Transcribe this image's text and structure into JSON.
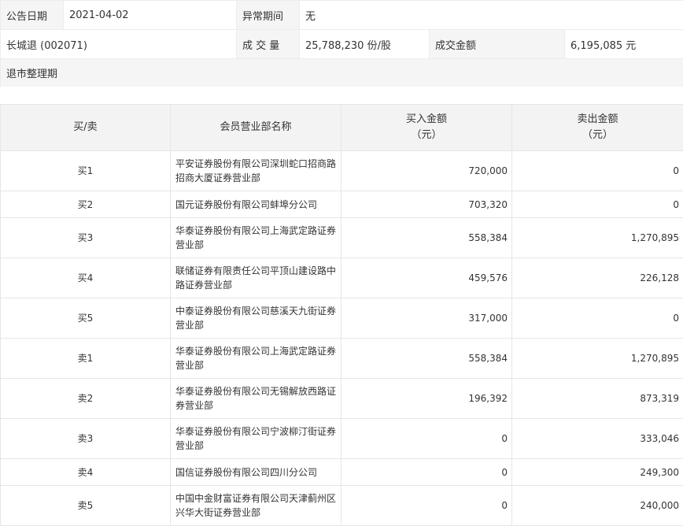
{
  "info": {
    "date_label": "公告日期",
    "date_value": "2021-04-02",
    "period_label": "异常期间",
    "period_value": "无",
    "stock": "长城退 (002071)",
    "volume_label": "成 交 量",
    "volume_value": "25,788,230 份/股",
    "amount_label": "成交金额",
    "amount_value": "6,195,085 元",
    "status": "退市整理期"
  },
  "table": {
    "headers": {
      "side": "买/卖",
      "branch": "会员营业部名称",
      "buy_amount": "买入金额",
      "buy_unit": "（元）",
      "sell_amount": "卖出金额",
      "sell_unit": "（元）"
    },
    "rows": [
      {
        "side": "买1",
        "name": "平安证券股份有限公司深圳蛇口招商路招商大厦证券营业部",
        "buy": "720,000",
        "sell": "0"
      },
      {
        "side": "买2",
        "name": "国元证券股份有限公司蚌埠分公司",
        "buy": "703,320",
        "sell": "0"
      },
      {
        "side": "买3",
        "name": "华泰证券股份有限公司上海武定路证券营业部",
        "buy": "558,384",
        "sell": "1,270,895"
      },
      {
        "side": "买4",
        "name": "联储证券有限责任公司平顶山建设路中路证券营业部",
        "buy": "459,576",
        "sell": "226,128"
      },
      {
        "side": "买5",
        "name": "中泰证券股份有限公司慈溪天九街证券营业部",
        "buy": "317,000",
        "sell": "0"
      },
      {
        "side": "卖1",
        "name": "华泰证券股份有限公司上海武定路证券营业部",
        "buy": "558,384",
        "sell": "1,270,895"
      },
      {
        "side": "卖2",
        "name": "华泰证券股份有限公司无锡解放西路证券营业部",
        "buy": "196,392",
        "sell": "873,319"
      },
      {
        "side": "卖3",
        "name": "华泰证券股份有限公司宁波柳汀街证券营业部",
        "buy": "0",
        "sell": "333,046"
      },
      {
        "side": "卖4",
        "name": "国信证券股份有限公司四川分公司",
        "buy": "0",
        "sell": "249,300"
      },
      {
        "side": "卖5",
        "name": "中国中金财富证券有限公司天津蓟州区兴华大街证券营业部",
        "buy": "0",
        "sell": "240,000"
      }
    ]
  }
}
